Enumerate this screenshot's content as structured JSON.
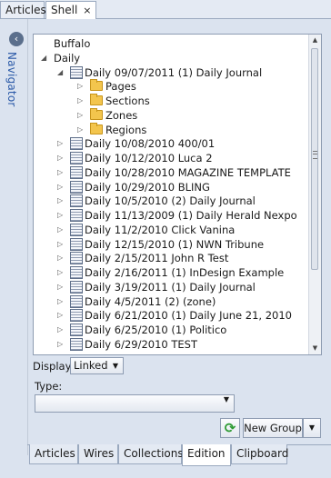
{
  "top_tabs": [
    {
      "label": "Articles",
      "active": false
    },
    {
      "label": "Shell",
      "active": true,
      "close": "×"
    }
  ],
  "navigator": {
    "label": "Navigator",
    "collapse_glyph": "‹"
  },
  "tree": {
    "rows": [
      {
        "label": "Buffalo",
        "level": 0,
        "expander": "",
        "icon": "none"
      },
      {
        "label": "Daily",
        "level": 0,
        "expander": "◢",
        "icon": "none"
      },
      {
        "label": "Daily 09/07/2011 (1) Daily Journal",
        "level": 1,
        "expander": "◢",
        "icon": "document"
      },
      {
        "label": "Pages",
        "level": 2,
        "expander": "▷",
        "icon": "folder"
      },
      {
        "label": "Sections",
        "level": 2,
        "expander": "▷",
        "icon": "folder"
      },
      {
        "label": "Zones",
        "level": 2,
        "expander": "▷",
        "icon": "folder"
      },
      {
        "label": "Regions",
        "level": 2,
        "expander": "▷",
        "icon": "folder"
      },
      {
        "label": "Daily 10/08/2010 400/01",
        "level": 1,
        "expander": "▷",
        "icon": "document"
      },
      {
        "label": "Daily 10/12/2010 Luca 2",
        "level": 1,
        "expander": "▷",
        "icon": "document"
      },
      {
        "label": "Daily 10/28/2010 MAGAZINE TEMPLATE",
        "level": 1,
        "expander": "▷",
        "icon": "document"
      },
      {
        "label": "Daily 10/29/2010 BLING",
        "level": 1,
        "expander": "▷",
        "icon": "document"
      },
      {
        "label": "Daily 10/5/2010 (2) Daily Journal",
        "level": 1,
        "expander": "▷",
        "icon": "document"
      },
      {
        "label": "Daily 11/13/2009 (1) Daily Herald Nexpo",
        "level": 1,
        "expander": "▷",
        "icon": "document"
      },
      {
        "label": "Daily 11/2/2010 Click Vanina",
        "level": 1,
        "expander": "▷",
        "icon": "document"
      },
      {
        "label": "Daily 12/15/2010 (1) NWN Tribune",
        "level": 1,
        "expander": "▷",
        "icon": "document"
      },
      {
        "label": "Daily 2/15/2011 John R Test",
        "level": 1,
        "expander": "▷",
        "icon": "document"
      },
      {
        "label": "Daily 2/16/2011 (1) InDesign Example",
        "level": 1,
        "expander": "▷",
        "icon": "document"
      },
      {
        "label": "Daily 3/19/2011 (1) Daily Journal",
        "level": 1,
        "expander": "▷",
        "icon": "document"
      },
      {
        "label": "Daily 4/5/2011 (2) (zone)",
        "level": 1,
        "expander": "▷",
        "icon": "document"
      },
      {
        "label": "Daily 6/21/2010 (1) Daily June 21, 2010",
        "level": 1,
        "expander": "▷",
        "icon": "document"
      },
      {
        "label": "Daily 6/25/2010 (1) Politico",
        "level": 1,
        "expander": "▷",
        "icon": "document"
      },
      {
        "label": "Daily 6/29/2010 TEST",
        "level": 1,
        "expander": "▷",
        "icon": "document"
      }
    ]
  },
  "display": {
    "label": "Display:",
    "value": "Linked"
  },
  "type": {
    "label": "Type:",
    "value": ""
  },
  "buttons": {
    "refresh_glyph": "⟳",
    "new_group": "New Group"
  },
  "bottom_tabs": [
    {
      "label": "Articles",
      "active": false
    },
    {
      "label": "Wires",
      "active": false
    },
    {
      "label": "Collections",
      "active": false
    },
    {
      "label": "Edition",
      "active": true
    },
    {
      "label": "Clipboard",
      "active": false
    }
  ]
}
